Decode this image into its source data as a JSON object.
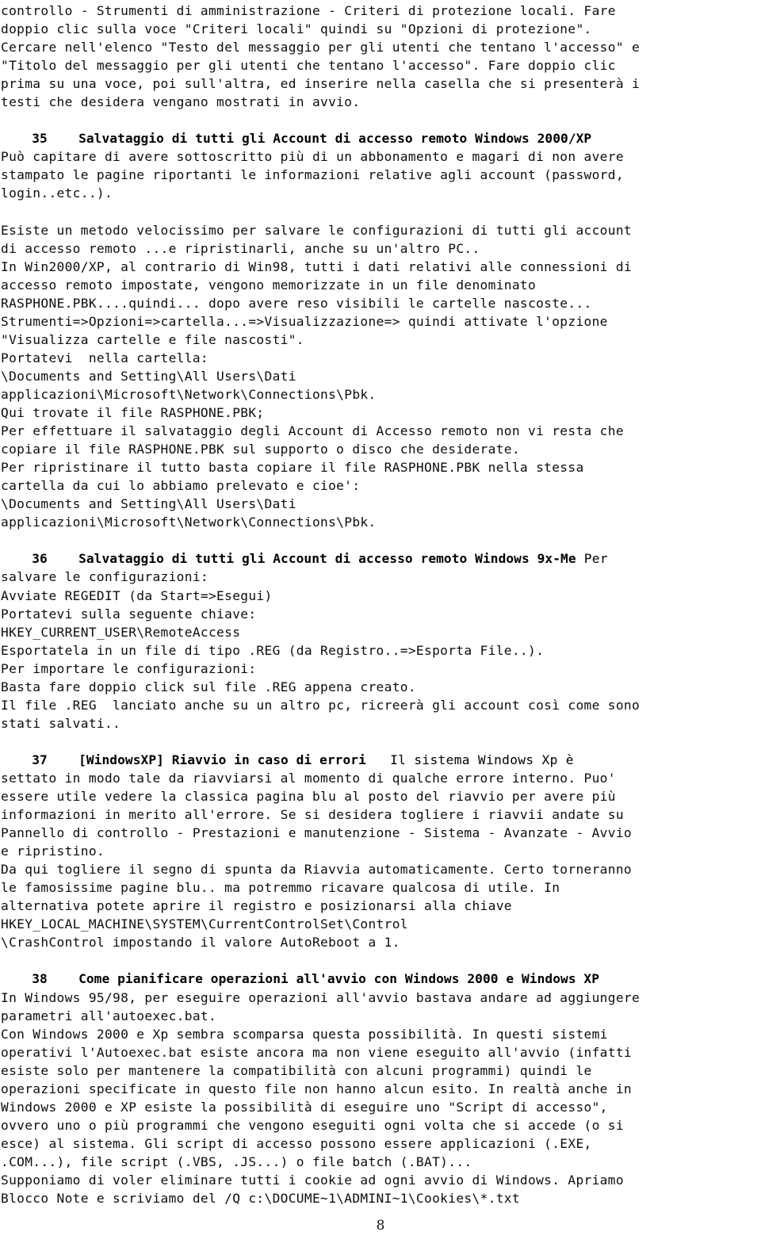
{
  "document": {
    "page_number": "8",
    "language": "it",
    "intro_lines": [
      "controllo - Strumenti di amministrazione - Criteri di protezione locali. Fare",
      "doppio clic sulla voce \"Criteri locali\" quindi su \"Opzioni di protezione\".",
      "Cercare nell'elenco \"Testo del messaggio per gli utenti che tentano l'accesso\" e",
      "\"Titolo del messaggio per gli utenti che tentano l'accesso\". Fare doppio clic",
      "prima su una voce, poi sull'altra, ed inserire nella casella che si presenterà i",
      "testi che desidera vengano mostrati in avvio."
    ],
    "sections": [
      {
        "number": "35",
        "heading": "Salvataggio di tutti gli Account di accesso remoto Windows 2000/XP",
        "heading_tail": "",
        "body_lines": [
          "Può capitare di avere sottoscritto più di un abbonamento e magari di non avere",
          "stampato le pagine riportanti le informazioni relative agli account (password,",
          "login..etc..).",
          "",
          "Esiste un metodo velocissimo per salvare le configurazioni di tutti gli account",
          "di accesso remoto ...e ripristinarli, anche su un'altro PC..",
          "In Win2000/XP, al contrario di Win98, tutti i dati relativi alle connessioni di",
          "accesso remoto impostate, vengono memorizzate in un file denominato",
          "RASPHONE.PBK....quindi... dopo avere reso visibili le cartelle nascoste...",
          "Strumenti=>Opzioni=>cartella...=>Visualizzazione=> quindi attivate l'opzione",
          "\"Visualizza cartelle e file nascosti\".",
          "Portatevi  nella cartella:",
          "\\Documents and Setting\\All Users\\Dati",
          "applicazioni\\Microsoft\\Network\\Connections\\Pbk.",
          "Qui trovate il file RASPHONE.PBK;",
          "Per effettuare il salvataggio degli Account di Accesso remoto non vi resta che",
          "copiare il file RASPHONE.PBK sul supporto o disco che desiderate.",
          "Per ripristinare il tutto basta copiare il file RASPHONE.PBK nella stessa",
          "cartella da cui lo abbiamo prelevato e cioe':",
          "\\Documents and Setting\\All Users\\Dati",
          "applicazioni\\Microsoft\\Network\\Connections\\Pbk."
        ]
      },
      {
        "number": "36",
        "heading": "Salvataggio di tutti gli Account di accesso remoto Windows 9x-Me",
        "heading_tail": " Per",
        "body_lines": [
          "salvare le configurazioni:",
          "Avviate REGEDIT (da Start=>Esegui)",
          "Portatevi sulla seguente chiave:",
          "HKEY_CURRENT_USER\\RemoteAccess",
          "Esportatela in un file di tipo .REG (da Registro..=>Esporta File..).",
          "Per importare le configurazioni:",
          "Basta fare doppio click sul file .REG appena creato.",
          "Il file .REG  lanciato anche su un altro pc, ricreerà gli account così come sono",
          "stati salvati.."
        ]
      },
      {
        "number": "37",
        "heading": "[WindowsXP] Riavvio in caso di errori",
        "heading_tail": "   Il sistema Windows Xp è",
        "body_lines": [
          "settato in modo tale da riavviarsi al momento di qualche errore interno. Puo'",
          "essere utile vedere la classica pagina blu al posto del riavvio per avere più",
          "informazioni in merito all'errore. Se si desidera togliere i riavvii andate su",
          "Pannello di controllo - Prestazioni e manutenzione - Sistema - Avanzate - Avvio",
          "e ripristino.",
          "Da qui togliere il segno di spunta da Riavvia automaticamente. Certo torneranno",
          "le famosissime pagine blu.. ma potremmo ricavare qualcosa di utile. In",
          "alternativa potete aprire il registro e posizionarsi alla chiave",
          "HKEY_LOCAL_MACHINE\\SYSTEM\\CurrentControlSet\\Control",
          "\\CrashControl impostando il valore AutoReboot a 1."
        ]
      },
      {
        "number": "38",
        "heading": "Come pianificare operazioni all'avvio con Windows 2000 e Windows XP",
        "heading_tail": "",
        "body_lines": [
          "In Windows 95/98, per eseguire operazioni all'avvio bastava andare ad aggiungere",
          "parametri all'autoexec.bat.",
          "Con Windows 2000 e Xp sembra scomparsa questa possibilità. In questi sistemi",
          "operativi l'Autoexec.bat esiste ancora ma non viene eseguito all'avvio (infatti",
          "esiste solo per mantenere la compatibilità con alcuni programmi) quindi le",
          "operazioni specificate in questo file non hanno alcun esito. In realtà anche in",
          "Windows 2000 e XP esiste la possibilità di eseguire uno \"Script di accesso\",",
          "ovvero uno o più programmi che vengono eseguiti ogni volta che si accede (o si",
          "esce) al sistema. Gli script di accesso possono essere applicazioni (.EXE,",
          ".COM...), file script (.VBS, .JS...) o file batch (.BAT)...",
          "Supponiamo di voler eliminare tutti i cookie ad ogni avvio di Windows. Apriamo",
          "Blocco Note e scriviamo del /Q c:\\DOCUME~1\\ADMINI~1\\Cookies\\*.txt"
        ]
      }
    ]
  }
}
